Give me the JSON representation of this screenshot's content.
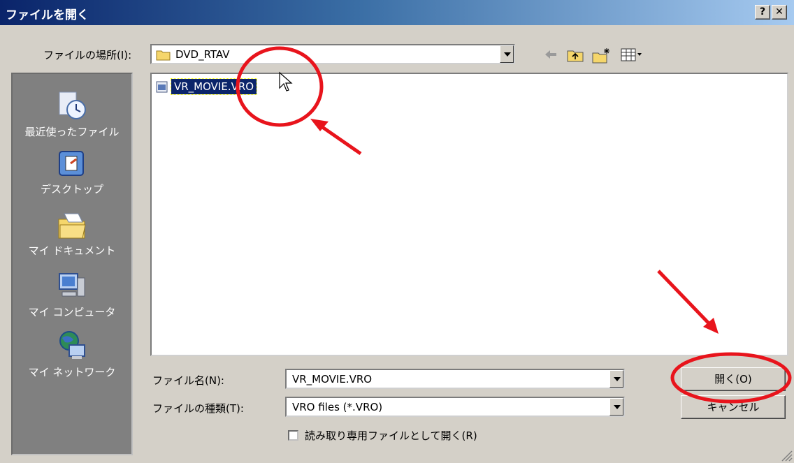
{
  "window": {
    "title": "ファイルを開く",
    "help_label": "?",
    "close_label": "✕"
  },
  "location": {
    "label": "ファイルの場所(I):",
    "value": "DVD_RTAV"
  },
  "toolbar": {
    "icons": [
      "back-icon",
      "up-folder-icon",
      "new-folder-icon",
      "view-menu-icon"
    ]
  },
  "places": [
    {
      "label": "最近使ったファイル",
      "icon": "recent-files-icon"
    },
    {
      "label": "デスクトップ",
      "icon": "desktop-icon"
    },
    {
      "label": "マイ ドキュメント",
      "icon": "my-documents-icon"
    },
    {
      "label": "マイ コンピュータ",
      "icon": "my-computer-icon"
    },
    {
      "label": "マイ ネットワーク",
      "icon": "my-network-icon"
    }
  ],
  "files": [
    {
      "name": "VR_MOVIE.VRO",
      "selected": true
    }
  ],
  "filename": {
    "label": "ファイル名(N):",
    "value": "VR_MOVIE.VRO"
  },
  "filetype": {
    "label": "ファイルの種類(T):",
    "value": "VRO files (*.VRO)"
  },
  "readonly": {
    "label": "読み取り専用ファイルとして開く(R)",
    "checked": false
  },
  "buttons": {
    "open": "開く(O)",
    "cancel": "キャンセル"
  },
  "colors": {
    "title_start": "#0a246a",
    "title_end": "#a6caf0",
    "annotation": "#e8141c",
    "selection": "#0a246a"
  }
}
